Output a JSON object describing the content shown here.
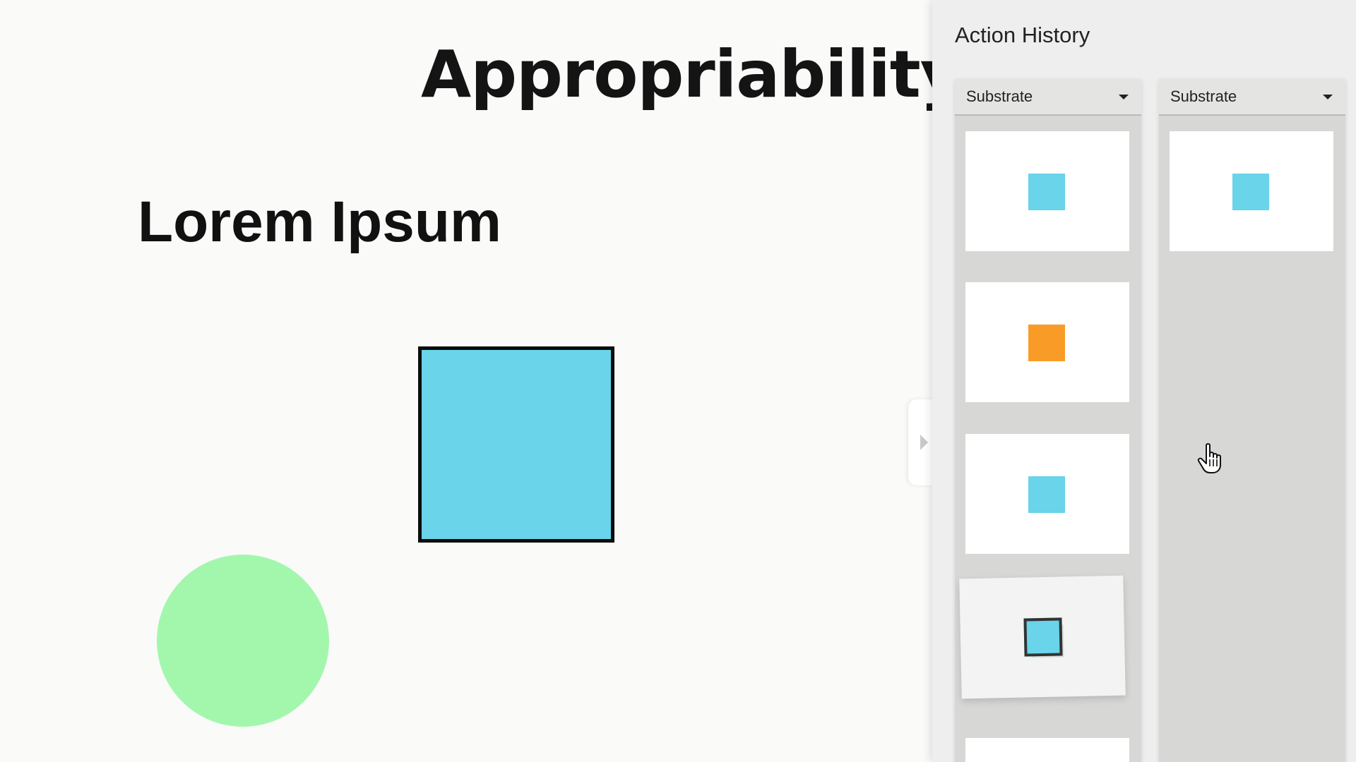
{
  "canvas": {
    "title": "Appropriability",
    "heading": "Lorem Ipsum",
    "shapes": {
      "square_color": "#69d4ea",
      "circle_color": "#a3f7ad"
    }
  },
  "panel": {
    "title": "Action History",
    "columns": [
      {
        "dropdown_label": "Substrate",
        "items": [
          {
            "shape": "square",
            "color": "#69d4ea"
          },
          {
            "shape": "square",
            "color": "#f89c27"
          },
          {
            "shape": "square",
            "color": "#69d4ea"
          },
          {
            "shape": "square-outlined",
            "color": "#69d4ea",
            "state": "dragging"
          },
          {
            "shape": "empty",
            "color": "#ffffff"
          }
        ]
      },
      {
        "dropdown_label": "Substrate",
        "items": [
          {
            "shape": "square",
            "color": "#69d4ea"
          }
        ]
      }
    ]
  },
  "icons": {
    "collapse": "chevron-right-icon",
    "cursor": "hand-pointer-icon",
    "dropdown": "caret-down-icon"
  }
}
